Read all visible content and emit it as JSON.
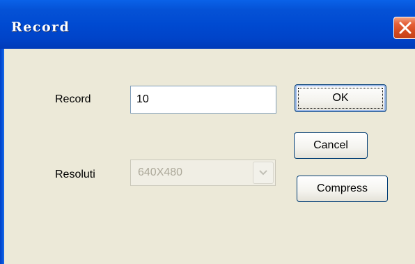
{
  "window": {
    "title": "Record",
    "close_icon": "close-x-icon"
  },
  "form": {
    "record_label": "Record",
    "record_value": "10",
    "resolution_label": "Resoluti",
    "resolution_value": "640X480",
    "resolution_enabled": false
  },
  "buttons": {
    "ok_label": "OK",
    "cancel_label": "Cancel",
    "compress_label": "Compress"
  },
  "colors": {
    "titlebar": "#0043c8",
    "dialog_background": "#ece9d8",
    "close_button": "#d34a1f"
  }
}
